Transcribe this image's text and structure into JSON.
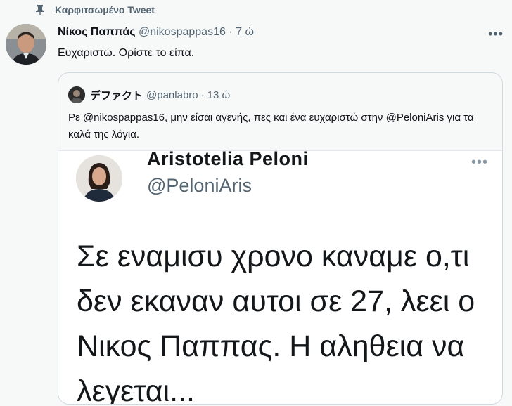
{
  "pinned": {
    "label": "Καρφιτσωμένο Tweet",
    "icon": "pin-icon"
  },
  "tweet": {
    "author_name": "Νίκος Παππάς",
    "author_handle": "@nikospappas16",
    "separator": "·",
    "time": "7 ώ",
    "text": "Ευχαριστώ. Ορίστε το είπα.",
    "more_icon": "more-icon"
  },
  "quoted": {
    "author_name": "デファクト",
    "author_handle": "@panlabro",
    "separator": "·",
    "time": "13 ώ",
    "text": "Ρε @nikospappas16, μην είσαι αγενής, πες και ένα ευχαριστώ στην @PeloniAris για τα καλά της λόγια."
  },
  "embedded_image": {
    "name": "Aristotelia Peloni",
    "handle": "@PeloniAris",
    "text": "Σε εναμισυ χρονο καναμε ο,τι δεν εκαναν αυτοι σε 27, λεει ο Νικος Παππας. Η αληθεια να λεγεται..."
  }
}
